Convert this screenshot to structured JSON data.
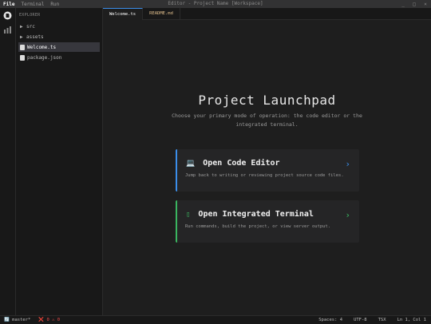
{
  "window": {
    "title": "Editor - Project Name [Workspace]"
  },
  "menu": [
    "File",
    "Terminal",
    "Run"
  ],
  "window_controls": [
    "_",
    "□",
    "×"
  ],
  "sidebar": {
    "header": "EXPLORER",
    "items": [
      {
        "label": "src",
        "kind": "folder",
        "glyph": "▶"
      },
      {
        "label": "assets",
        "kind": "folder",
        "glyph": "▶"
      },
      {
        "label": "Welcome.ts",
        "kind": "file",
        "selected": true
      },
      {
        "label": "package.json",
        "kind": "file"
      }
    ]
  },
  "tabs": [
    {
      "label": "Welcome.ts",
      "active": true
    },
    {
      "label": "README.md",
      "active": false
    }
  ],
  "main": {
    "title": "Project Launchpad",
    "subtitle": "Choose your primary mode of operation: the code editor or the integrated terminal.",
    "cards": [
      {
        "title": "Open Code Editor",
        "icon": "laptop-icon",
        "icon_glyph": "💻",
        "description": "Jump back to writing or reviewing project source code files.",
        "accent": "#3b8eea"
      },
      {
        "title": "Open Integrated Terminal",
        "icon": "terminal-icon",
        "icon_glyph": "▯",
        "description": "Run commands, build the project, or view server output.",
        "accent": "#3ab660"
      }
    ],
    "chevron": "›"
  },
  "statusbar": {
    "branch": "master*",
    "branch_icon": "🔄",
    "problems": "❌ 0 ⚠ 0",
    "spaces": "Spaces: 4",
    "encoding": "UTF-8",
    "language": "TSX",
    "position": "Ln 1, Col 1"
  },
  "colors": {
    "background": "#1e1e1e",
    "sidebar": "#181818",
    "card": "#252526",
    "accent_blue": "#3b8eea",
    "accent_green": "#3ab660",
    "error": "#f14c4c"
  }
}
